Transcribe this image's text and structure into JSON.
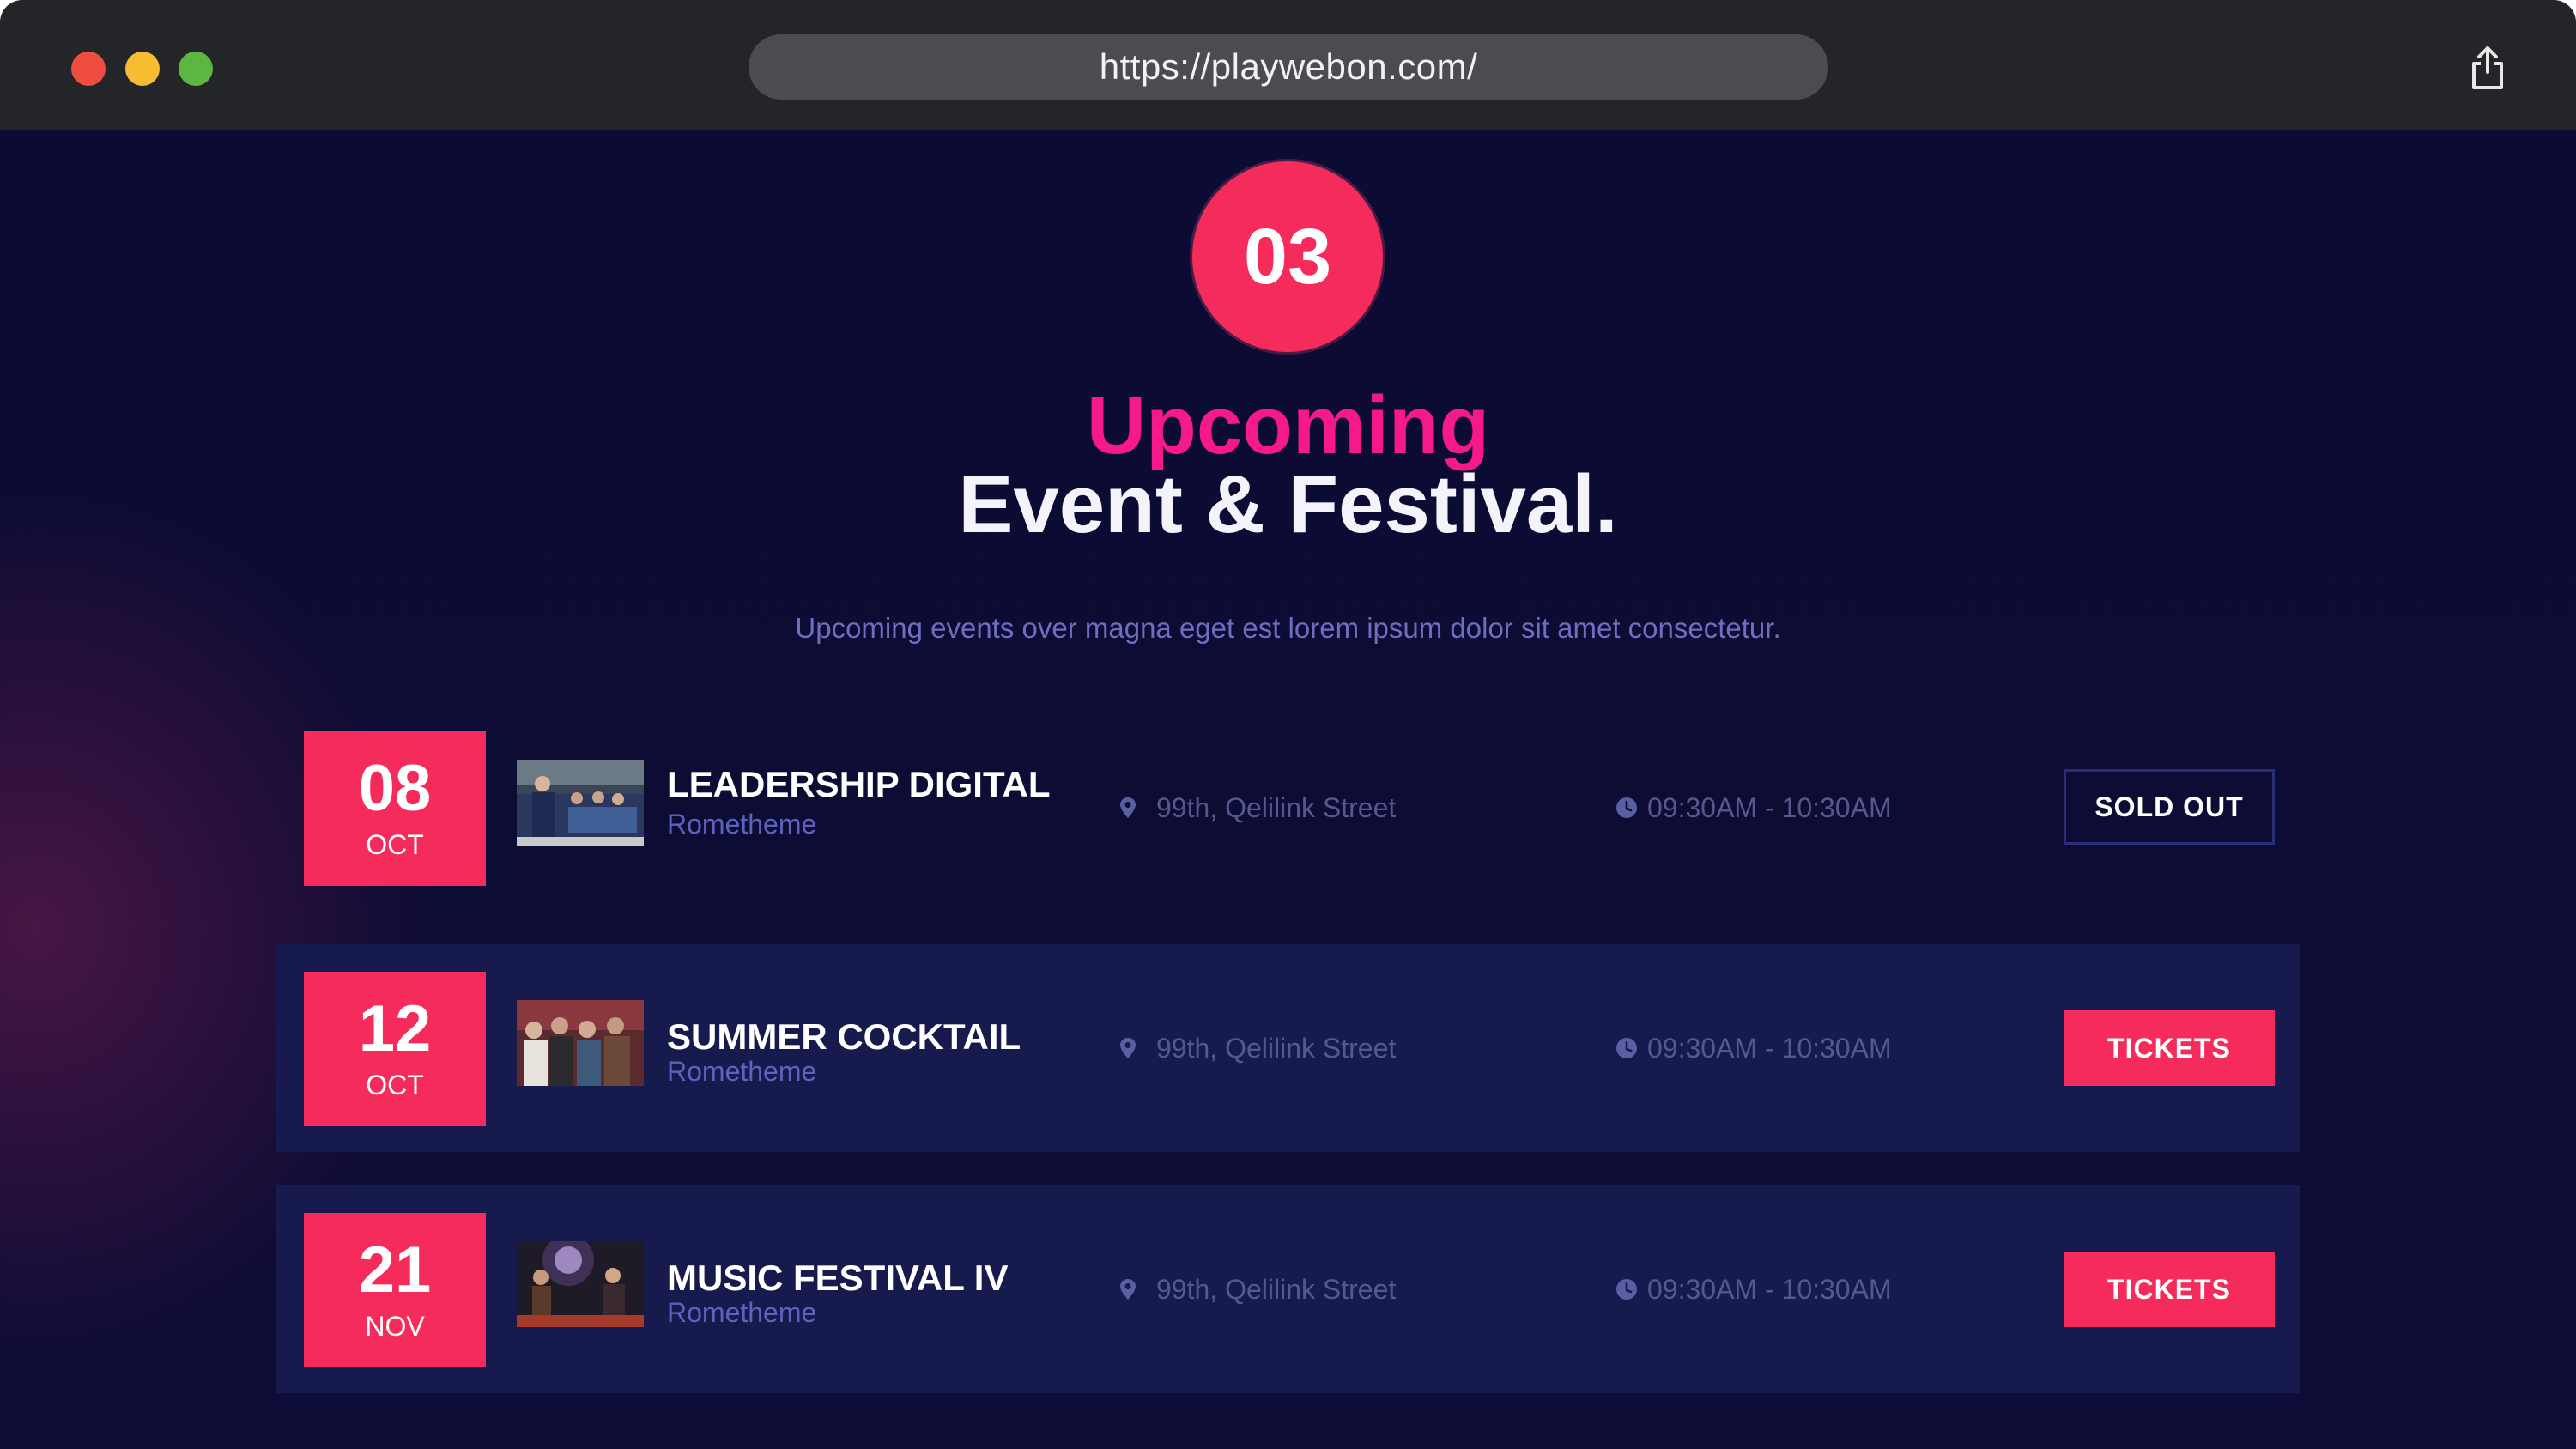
{
  "browser": {
    "url": "https://playwebon.com/"
  },
  "section": {
    "number": "03",
    "title_highlight": "Upcoming",
    "title_main": "Event & Festival.",
    "subtitle": "Upcoming events over magna eget est lorem ipsum dolor sit amet consectetur."
  },
  "events": [
    {
      "day": "08",
      "month": "OCT",
      "title": "LEADERSHIP DIGITAL",
      "organizer": "Rometheme",
      "location": "99th, Qelilink Street",
      "time": "09:30AM - 10:30AM",
      "button": "SOLD OUT"
    },
    {
      "day": "12",
      "month": "OCT",
      "title": "SUMMER COCKTAIL",
      "organizer": "Rometheme",
      "location": "99th, Qelilink Street",
      "time": "09:30AM - 10:30AM",
      "button": "TICKETS"
    },
    {
      "day": "21",
      "month": "NOV",
      "title": "MUSIC FESTIVAL IV",
      "organizer": "Rometheme",
      "location": "99th, Qelilink Street",
      "time": "09:30AM - 10:30AM",
      "button": "TICKETS"
    }
  ],
  "colors": {
    "accent": "#f52b5b",
    "title_pink": "#f5198a",
    "page_bg": "#0c0b33",
    "row_bg": "#171a4d"
  },
  "icons": {
    "location": "map-pin-icon",
    "time": "clock-icon",
    "share": "share-icon"
  }
}
